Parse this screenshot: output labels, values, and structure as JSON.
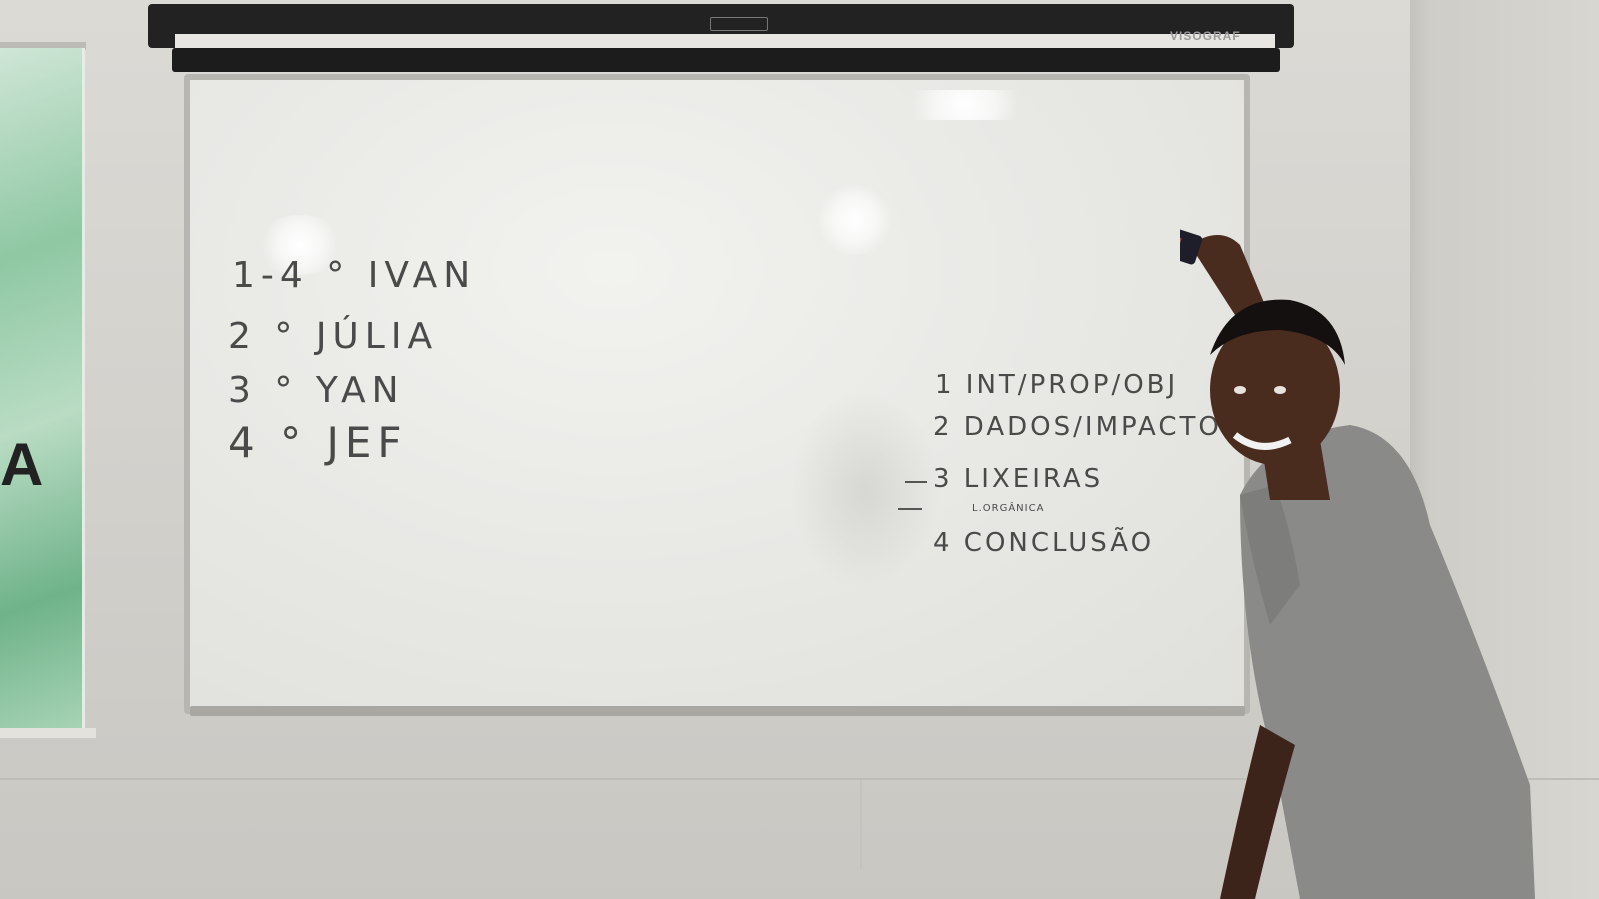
{
  "board": {
    "left_list": [
      {
        "num": "1-4",
        "sep": "°",
        "name": "IVAN"
      },
      {
        "num": "2",
        "sep": "°",
        "name": "JÚLIA"
      },
      {
        "num": "3",
        "sep": "°",
        "name": "YAN"
      },
      {
        "num": "4",
        "sep": "°",
        "name": "JEF"
      }
    ],
    "right_list": [
      "1 INT/PROP/OBJ",
      "2 DADOS/IMPACTOS",
      "3 LIXEIRAS",
      "4 CONCLUSÃO"
    ],
    "small_note": "L.ORGÂNICA"
  },
  "projector": {
    "brand": "VISOGRAF"
  },
  "colors": {
    "marker": "#4a4a4a",
    "board": "#e9e9e6",
    "shirt": "#8a8a88",
    "skin": "#4a2c1f"
  }
}
